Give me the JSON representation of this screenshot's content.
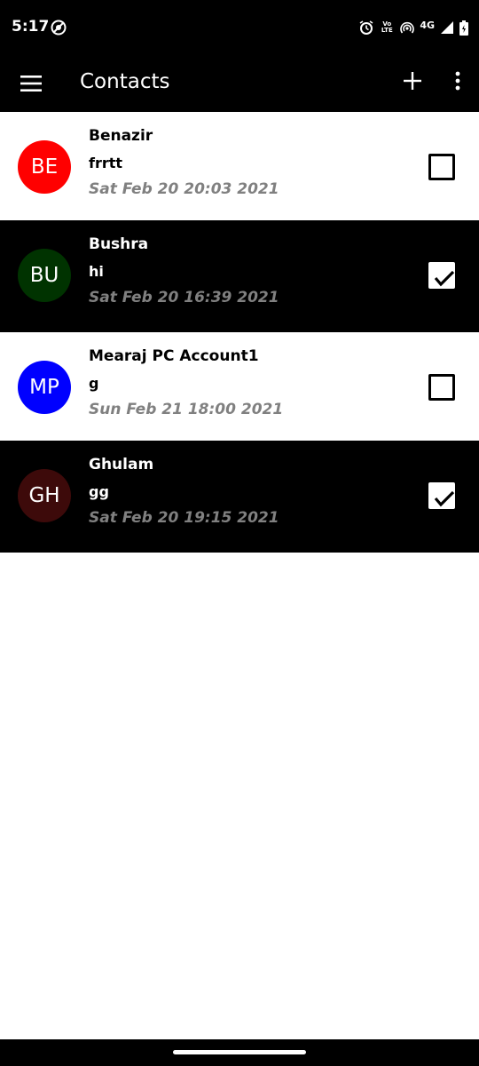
{
  "status_bar": {
    "time": "5:17",
    "icons": [
      "data-saver-icon",
      "alarm-icon",
      "volte-icon",
      "hotspot-icon",
      "signal-icon",
      "battery-icon"
    ],
    "volte_top": "Vo",
    "volte_bottom": "LTE",
    "network": "4G"
  },
  "app_bar": {
    "title": "Contacts",
    "icons": [
      "menu-icon",
      "add-icon",
      "more-vert-icon"
    ]
  },
  "contacts": [
    {
      "initials": "BE",
      "name": "Benazir",
      "message": "frrtt",
      "time": "Sat Feb 20 20:03 2021",
      "avatar_color": "#ff0000",
      "checked": false,
      "theme": "light"
    },
    {
      "initials": "BU",
      "name": "Bushra",
      "message": "hi",
      "time": "Sat Feb 20 16:39 2021",
      "avatar_color": "#003300",
      "checked": true,
      "theme": "dark"
    },
    {
      "initials": "MP",
      "name": "Mearaj PC Account1",
      "message": "g",
      "time": "Sun Feb 21 18:00 2021",
      "avatar_color": "#0000ff",
      "checked": false,
      "theme": "light"
    },
    {
      "initials": "GH",
      "name": "Ghulam",
      "message": "gg",
      "time": "Sat Feb 20 19:15 2021",
      "avatar_color": "#3d0a0a",
      "checked": true,
      "theme": "dark"
    }
  ],
  "colors": {
    "bar_background": "#000000",
    "timestamp": "#808080"
  }
}
